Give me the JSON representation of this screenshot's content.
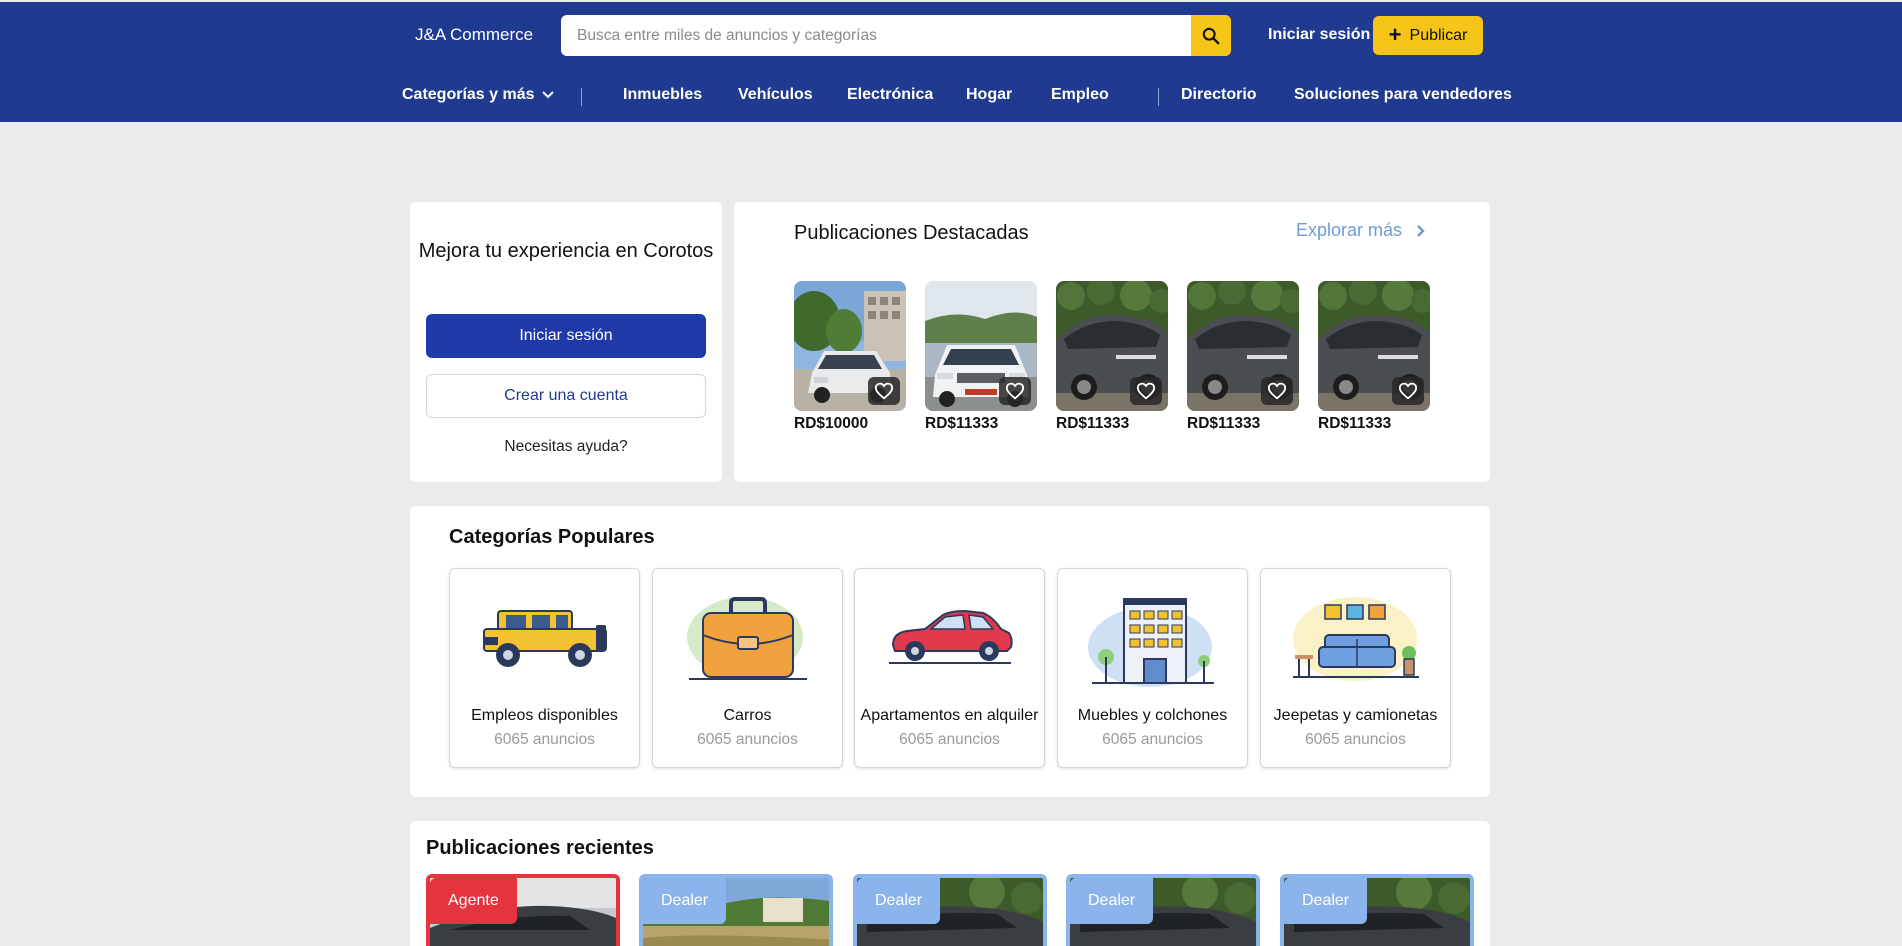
{
  "header": {
    "brand": "J&A Commerce",
    "search_placeholder": "Busca entre miles de anuncios y categorías",
    "login_label": "Iniciar sesión",
    "publish_label": "Publicar",
    "nav": {
      "categories_label": "Categorías y más",
      "items": [
        "Inmuebles",
        "Vehículos",
        "Electrónica",
        "Hogar",
        "Empleo",
        "Directorio",
        "Soluciones para vendedores"
      ]
    }
  },
  "welcome": {
    "title": "Mejora tu experiencia en Corotos",
    "login_label": "Iniciar sesión",
    "create_account_label": "Crear una cuenta",
    "help_label": "Necesitas ayuda?"
  },
  "featured": {
    "title": "Publicaciones Destacadas",
    "explore_label": "Explorar más",
    "items": [
      {
        "price": "RD$10000"
      },
      {
        "price": "RD$11333"
      },
      {
        "price": "RD$11333"
      },
      {
        "price": "RD$11333"
      },
      {
        "price": "RD$11333"
      }
    ]
  },
  "popular": {
    "title": "Categorías Populares",
    "items": [
      {
        "name": "Empleos disponibles",
        "count": "6065 anuncios",
        "icon": "jeep-icon"
      },
      {
        "name": "Carros",
        "count": "6065 anuncios",
        "icon": "briefcase-icon"
      },
      {
        "name": "Apartamentos en alquiler",
        "count": "6065 anuncios",
        "icon": "car-icon"
      },
      {
        "name": "Muebles y colchones",
        "count": "6065 anuncios",
        "icon": "building-icon"
      },
      {
        "name": "Jeepetas y camionetas",
        "count": "6065 anuncios",
        "icon": "sofa-icon"
      }
    ]
  },
  "recent": {
    "title": "Publicaciones recientes",
    "items": [
      {
        "badge": "Agente",
        "badge_color": "#e5343d"
      },
      {
        "badge": "Dealer",
        "badge_color": "#8bb4ec"
      },
      {
        "badge": "Dealer",
        "badge_color": "#8bb4ec"
      },
      {
        "badge": "Dealer",
        "badge_color": "#8bb4ec"
      },
      {
        "badge": "Dealer",
        "badge_color": "#8bb4ec"
      }
    ]
  },
  "colors": {
    "primary": "#1f3a8f",
    "accent": "#f5c518",
    "link": "#6f9bd1"
  }
}
